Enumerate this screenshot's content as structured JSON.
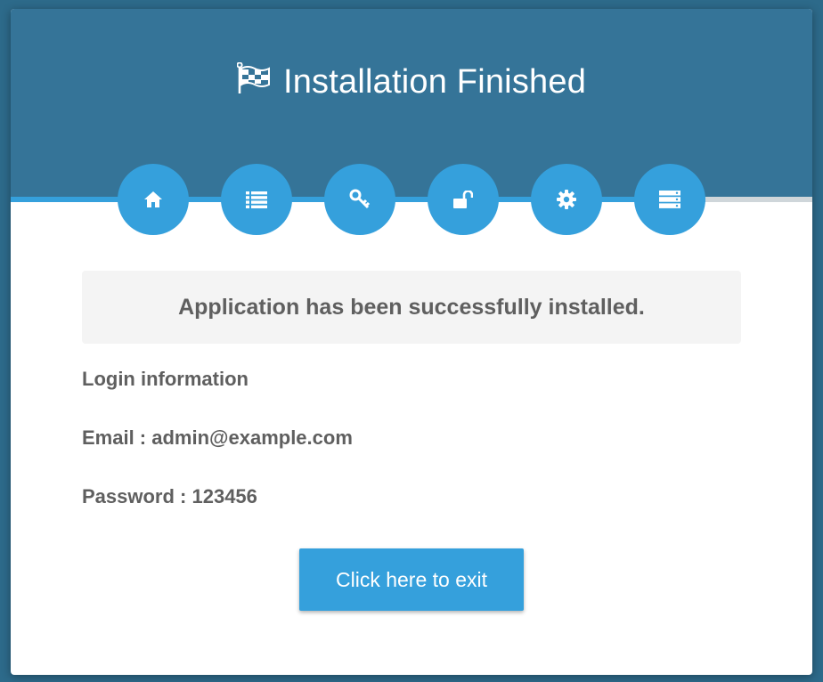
{
  "header": {
    "title": "Installation Finished",
    "icon": "flag-checkered-icon",
    "background_color": "#357498"
  },
  "steps": [
    {
      "name": "home",
      "icon": "home-icon",
      "completed": true
    },
    {
      "name": "requirements",
      "icon": "list-icon",
      "completed": true
    },
    {
      "name": "permissions",
      "icon": "key-icon",
      "completed": true
    },
    {
      "name": "environment",
      "icon": "unlock-icon",
      "completed": true
    },
    {
      "name": "settings",
      "icon": "gear-icon",
      "completed": true
    },
    {
      "name": "database",
      "icon": "server-icon",
      "completed": true
    }
  ],
  "accent_color": "#35a0dc",
  "notice": {
    "message": "Application has been successfully installed."
  },
  "login": {
    "heading": "Login information",
    "email_line": "Email : admin@example.com",
    "password_line": "Password : 123456"
  },
  "exit_button": {
    "label": "Click here to exit"
  }
}
